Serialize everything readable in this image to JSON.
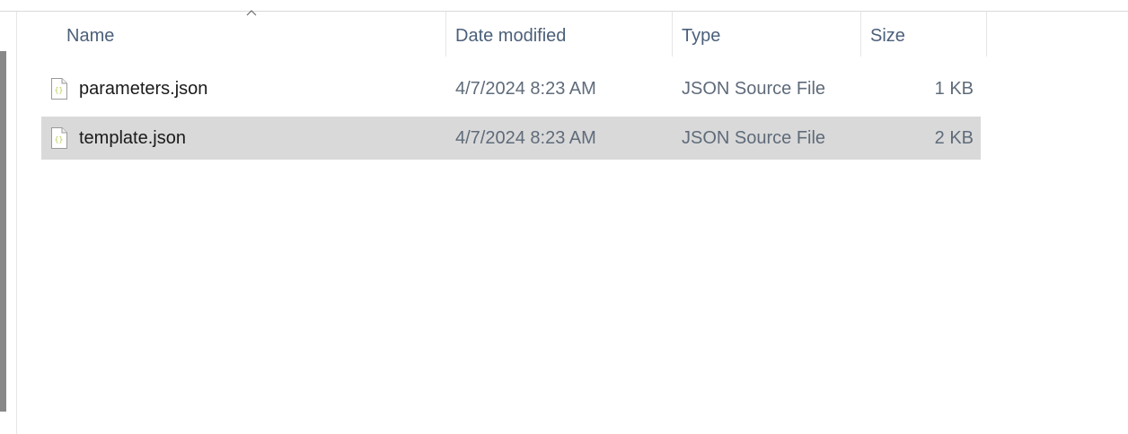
{
  "columns": {
    "name": "Name",
    "date_modified": "Date modified",
    "type": "Type",
    "size": "Size"
  },
  "sort": {
    "column": "name",
    "direction": "ascending",
    "icon": "chevron-up-icon"
  },
  "files": [
    {
      "name": "parameters.json",
      "date_modified": "4/7/2024 8:23 AM",
      "type": "JSON Source File",
      "size": "1 KB",
      "icon": "json-file-icon",
      "selected": false
    },
    {
      "name": "template.json",
      "date_modified": "4/7/2024 8:23 AM",
      "type": "JSON Source File",
      "size": "2 KB",
      "icon": "json-file-icon",
      "selected": true
    }
  ],
  "colors": {
    "header_text": "#4c607a",
    "selected_row": "#d9d9d9",
    "json_icon_accent": "#b8c94a"
  }
}
